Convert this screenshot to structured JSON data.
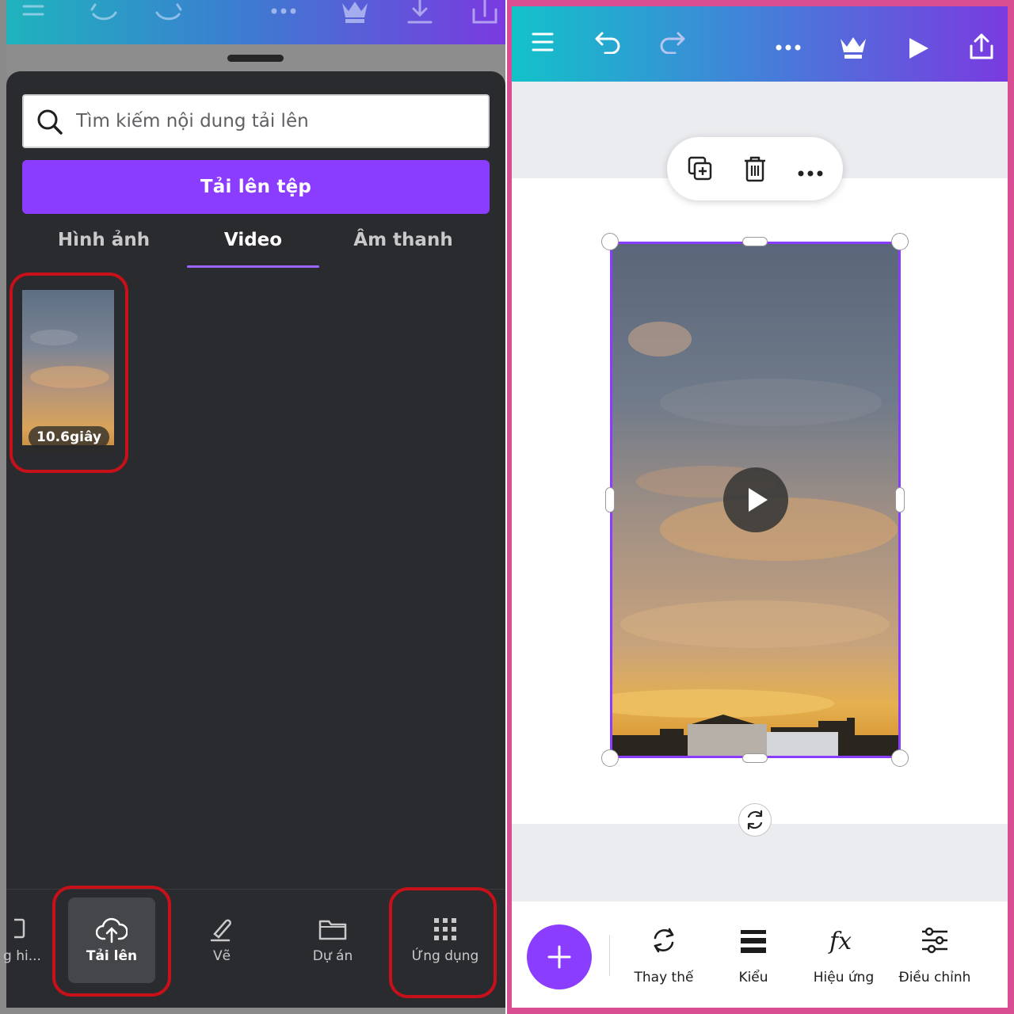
{
  "left_panel": {
    "topbar_icons": [
      "menu-icon",
      "undo-icon",
      "redo-icon",
      "more-icon",
      "crown-icon",
      "download-icon",
      "share-icon"
    ],
    "search": {
      "placeholder": "Tìm kiếm nội dung tải lên"
    },
    "upload_button": "Tải lên tệp",
    "tabs": [
      {
        "label": "Hình ảnh",
        "active": false
      },
      {
        "label": "Video",
        "active": true
      },
      {
        "label": "Âm thanh",
        "active": false
      }
    ],
    "video_item": {
      "duration": "10.6giây"
    },
    "bottom_nav": [
      {
        "label": "g hi...",
        "icon": "template-icon"
      },
      {
        "label": "Tải lên",
        "icon": "cloud-upload-icon",
        "active": true
      },
      {
        "label": "Vẽ",
        "icon": "draw-icon"
      },
      {
        "label": "Dự án",
        "icon": "folder-icon"
      },
      {
        "label": "Ứng dụng",
        "icon": "apps-grid-icon"
      }
    ],
    "highlight_color": "#c7101a"
  },
  "right_panel": {
    "topbar_icons": [
      "menu-icon",
      "undo-icon",
      "redo-icon",
      "more-icon",
      "crown-icon",
      "play-icon",
      "share-icon"
    ],
    "floating_toolbar_icons": [
      "duplicate-icon",
      "trash-icon",
      "more-icon"
    ],
    "bottom_toolbar": {
      "add_icon": "plus-icon",
      "tools": [
        {
          "label": "Thay thế",
          "icon": "replace-icon"
        },
        {
          "label": "Kiểu",
          "icon": "style-icon"
        },
        {
          "label": "Hiệu ứng",
          "icon": "fx-icon"
        },
        {
          "label": "Điều chỉnh",
          "icon": "adjust-icon"
        }
      ]
    },
    "accent_color": "#8b3dff"
  }
}
